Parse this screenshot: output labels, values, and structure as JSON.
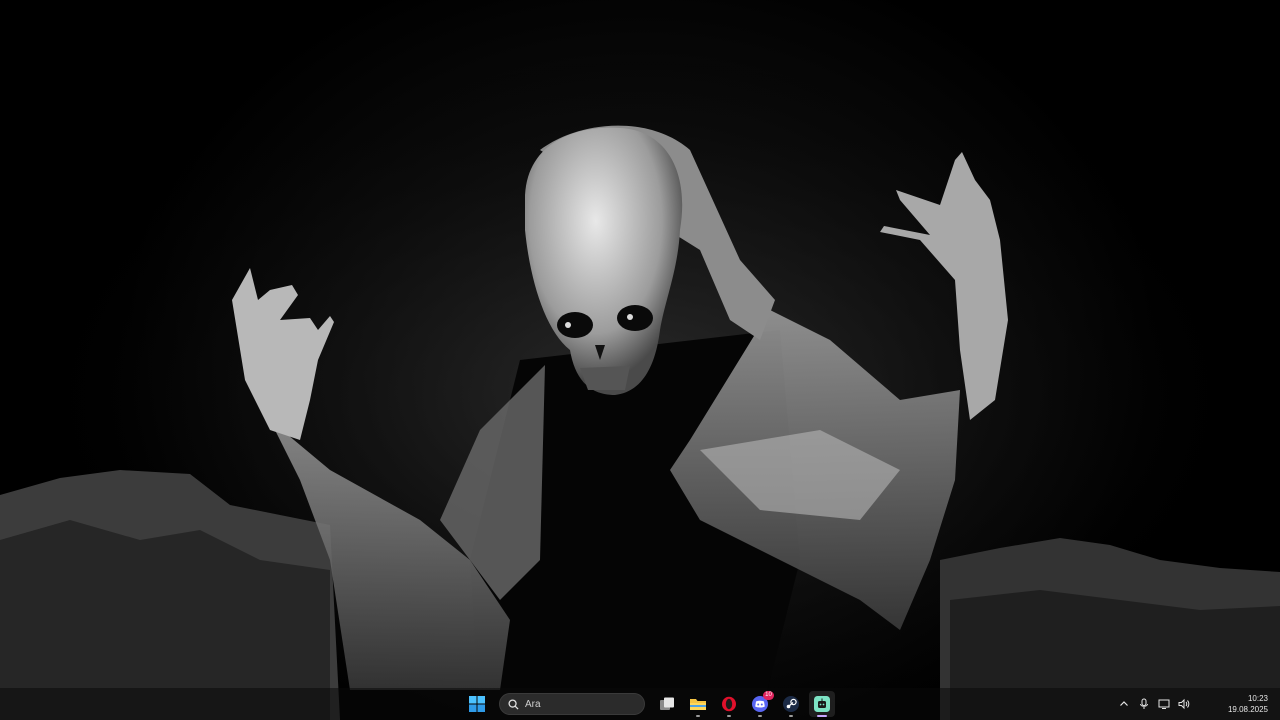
{
  "wallpaper": {
    "description_icon": "grim-reaper-wallpaper"
  },
  "taskbar": {
    "start_icon": "windows-start-icon",
    "search_placeholder": "Ara",
    "apps": [
      {
        "name": "task-view",
        "icon": "task-view-icon"
      },
      {
        "name": "file-explorer",
        "icon": "folder-icon"
      },
      {
        "name": "opera",
        "icon": "opera-icon"
      },
      {
        "name": "discord",
        "icon": "discord-icon",
        "badge": "10"
      },
      {
        "name": "steam",
        "icon": "steam-icon"
      },
      {
        "name": "app",
        "icon": "app-icon",
        "active": true
      }
    ],
    "accent": "#c8a8ff"
  },
  "tray": {
    "icons": [
      "chevron-up-icon",
      "microphone-icon",
      "display-icon",
      "speaker-icon"
    ],
    "time": "10:23",
    "date": "19.08.2025"
  }
}
